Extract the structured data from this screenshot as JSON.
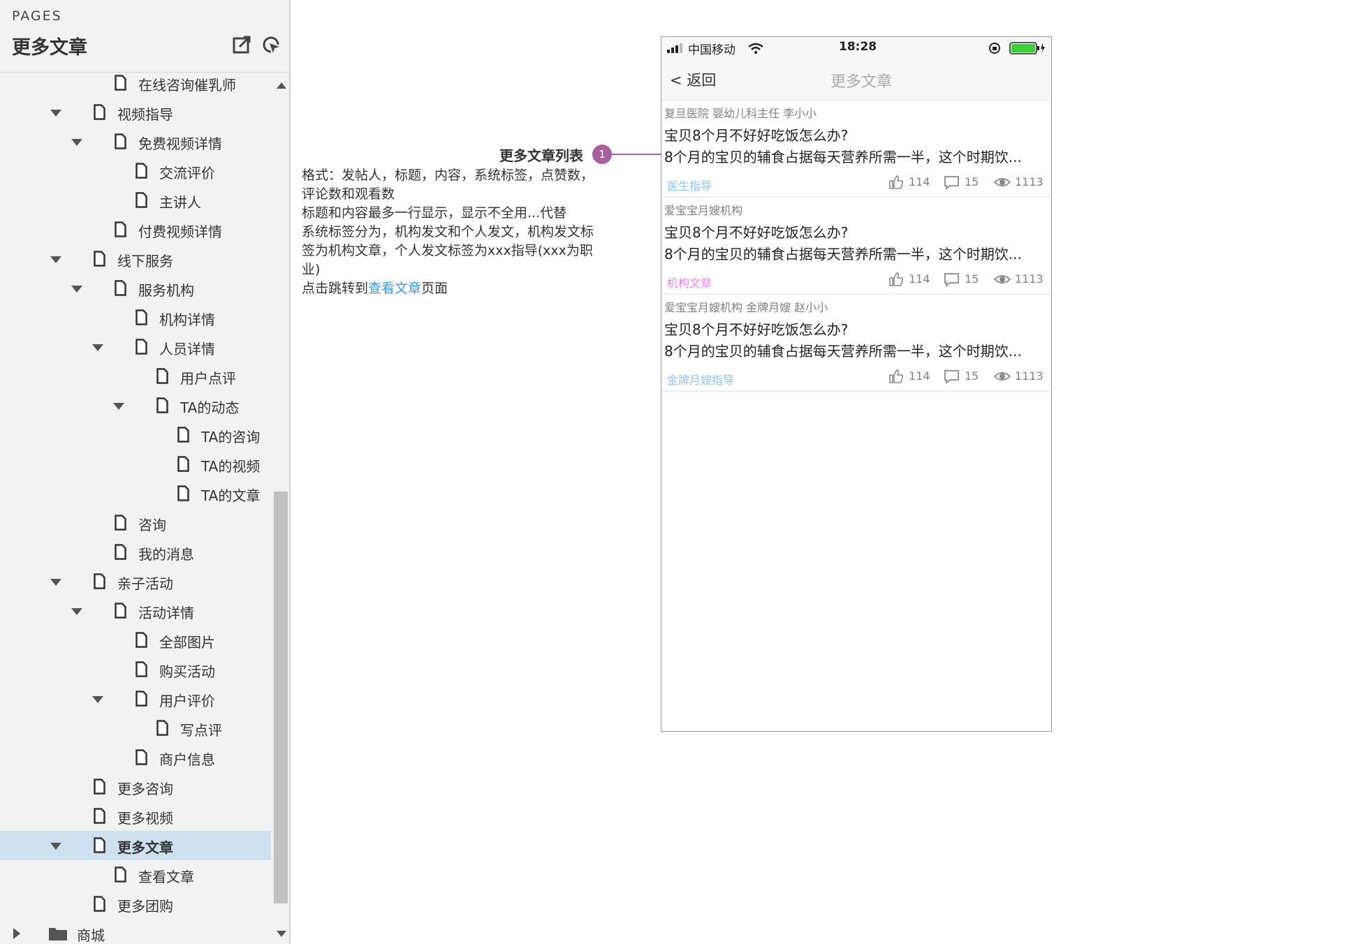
{
  "sidebar": {
    "pages_label": "PAGES",
    "title": "更多文章",
    "header_icons": [
      "export-icon",
      "locate-page-icon"
    ],
    "tree": [
      {
        "label": "在线咨询催乳师",
        "level": 2,
        "expanded": null,
        "type": "page"
      },
      {
        "label": "视频指导",
        "level": 1,
        "expanded": true,
        "type": "page"
      },
      {
        "label": "免费视频详情",
        "level": 2,
        "expanded": true,
        "type": "page"
      },
      {
        "label": "交流评价",
        "level": 3,
        "expanded": null,
        "type": "page"
      },
      {
        "label": "主讲人",
        "level": 3,
        "expanded": null,
        "type": "page"
      },
      {
        "label": "付费视频详情",
        "level": 2,
        "expanded": null,
        "type": "page"
      },
      {
        "label": "线下服务",
        "level": 1,
        "expanded": true,
        "type": "page"
      },
      {
        "label": "服务机构",
        "level": 2,
        "expanded": true,
        "type": "page"
      },
      {
        "label": "机构详情",
        "level": 3,
        "expanded": null,
        "type": "page"
      },
      {
        "label": "人员详情",
        "level": 3,
        "expanded": true,
        "type": "page"
      },
      {
        "label": "用户点评",
        "level": 4,
        "expanded": null,
        "type": "page"
      },
      {
        "label": "TA的动态",
        "level": 4,
        "expanded": true,
        "type": "page"
      },
      {
        "label": "TA的咨询",
        "level": 5,
        "expanded": null,
        "type": "page"
      },
      {
        "label": "TA的视频",
        "level": 5,
        "expanded": null,
        "type": "page"
      },
      {
        "label": "TA的文章",
        "level": 5,
        "expanded": null,
        "type": "page"
      },
      {
        "label": "咨询",
        "level": 2,
        "expanded": null,
        "type": "page"
      },
      {
        "label": "我的消息",
        "level": 2,
        "expanded": null,
        "type": "page"
      },
      {
        "label": "亲子活动",
        "level": 1,
        "expanded": true,
        "type": "page"
      },
      {
        "label": "活动详情",
        "level": 2,
        "expanded": true,
        "type": "page"
      },
      {
        "label": "全部图片",
        "level": 3,
        "expanded": null,
        "type": "page"
      },
      {
        "label": "购买活动",
        "level": 3,
        "expanded": null,
        "type": "page"
      },
      {
        "label": "用户评价",
        "level": 3,
        "expanded": true,
        "type": "page"
      },
      {
        "label": "写点评",
        "level": 4,
        "expanded": null,
        "type": "page"
      },
      {
        "label": "商户信息",
        "level": 3,
        "expanded": null,
        "type": "page"
      },
      {
        "label": "更多咨询",
        "level": 1,
        "expanded": null,
        "type": "page"
      },
      {
        "label": "更多视频",
        "level": 1,
        "expanded": null,
        "type": "page"
      },
      {
        "label": "更多文章",
        "level": 1,
        "expanded": true,
        "type": "page",
        "selected": true
      },
      {
        "label": "查看文章",
        "level": 2,
        "expanded": null,
        "type": "page"
      },
      {
        "label": "更多团购",
        "level": 1,
        "expanded": null,
        "type": "page"
      },
      {
        "label": "商城",
        "level": 0,
        "expanded": false,
        "type": "folder"
      }
    ]
  },
  "annotation": {
    "title": "更多文章列表",
    "badge": "1",
    "badge_color": "#a8619d",
    "lines": [
      "格式：发帖人，标题，内容，系统标签，点赞数，评论数和观看数",
      "标题和内容最多一行显示，显示不全用...代替",
      "系统标签分为，机构发文和个人发文，机构发文标签为机构文章，个人发文标签为xxx指导(xxx为职业)"
    ],
    "link_prefix": "点击跳转到",
    "link_text": "查看文章",
    "link_suffix": "页面",
    "link_color": "#3d9ad8"
  },
  "phone": {
    "carrier": "中国移动",
    "time": "18:28",
    "back_label": "< 返回",
    "nav_title": "更多文章",
    "articles": [
      {
        "author": "复旦医院   婴幼儿科主任   李小小",
        "title": "宝贝8个月不好好吃饭怎么办?",
        "content": "8个月的宝贝的辅食占据每天营养所需一半，这个时期饮...",
        "tag": "医生指导",
        "tag_color": "#8fc3ea",
        "likes": "114",
        "comments": "15",
        "views": "1113"
      },
      {
        "author": "爱宝宝月嫂机构",
        "title": "宝贝8个月不好好吃饭怎么办?",
        "content": "8个月的宝贝的辅食占据每天营养所需一半，这个时期饮...",
        "tag": "机构文章",
        "tag_color": "#ee82ee",
        "likes": "114",
        "comments": "15",
        "views": "1113"
      },
      {
        "author": "爱宝宝月嫂机构   金牌月嫂   赵小小",
        "title": "宝贝8个月不好好吃饭怎么办?",
        "content": "8个月的宝贝的辅食占据每天营养所需一半，这个时期饮...",
        "tag": "金牌月嫂指导",
        "tag_color": "#8fc3ea",
        "likes": "114",
        "comments": "15",
        "views": "1113"
      }
    ]
  }
}
